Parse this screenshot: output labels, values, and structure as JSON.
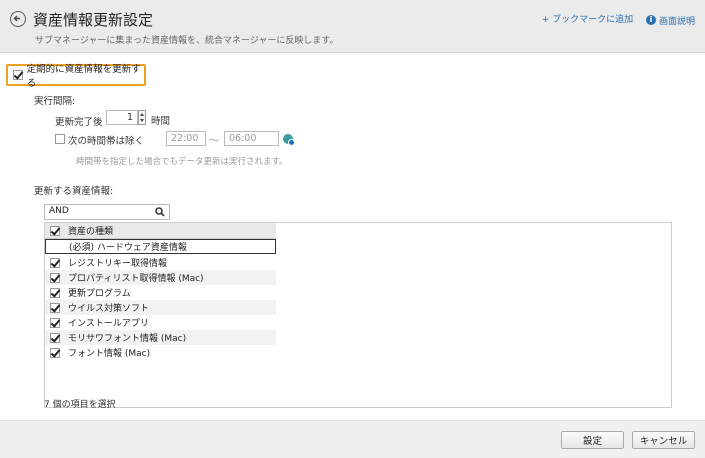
{
  "header": {
    "title": "資産情報更新設定",
    "subtitle": "サブマネージャーに集まった資産情報を、統合マネージャーに反映します。",
    "bookmark_link": "+ ブックマークに追加",
    "help_link": "画面説明"
  },
  "schedule": {
    "periodic_label": "定期的に資産情報を更新する",
    "periodic_checked": true,
    "interval_heading": "実行間隔:",
    "after_update_label": "更新完了後",
    "hours_value": "1",
    "hours_unit": "時間",
    "exclude_label": "次の時間帯は除く",
    "exclude_checked": false,
    "exclude_from": "22:00",
    "tilde": "〜",
    "exclude_to": "06:00",
    "exclude_note": "時間帯を指定した場合でもデータ更新は実行されます。"
  },
  "assets": {
    "heading": "更新する資産情報:",
    "search_value": "AND",
    "column_header": "資産の種類",
    "items": [
      {
        "label": "(必須) ハードウェア資産情報",
        "checked": false,
        "required": true
      },
      {
        "label": "レジストリキー取得情報",
        "checked": true
      },
      {
        "label": "プロパティリスト取得情報 (Mac)",
        "checked": true
      },
      {
        "label": "更新プログラム",
        "checked": true
      },
      {
        "label": "ウイルス対策ソフト",
        "checked": true
      },
      {
        "label": "インストールアプリ",
        "checked": true
      },
      {
        "label": "モリサワフォント情報 (Mac)",
        "checked": true
      },
      {
        "label": "フォント情報 (Mac)",
        "checked": true
      }
    ],
    "selected_count": "7 個の項目を選択"
  },
  "footer": {
    "ok_label": "設定",
    "cancel_label": "キャンセル"
  },
  "colors": {
    "highlight_border": "#f0a020",
    "link": "#2a6fb0"
  }
}
